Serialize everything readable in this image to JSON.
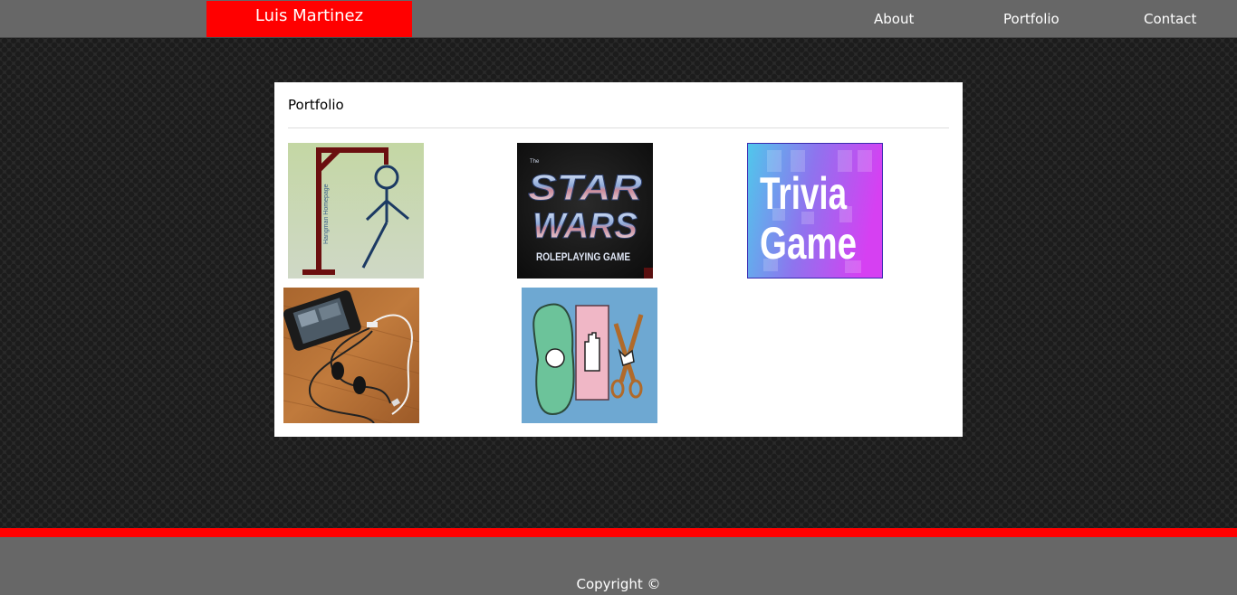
{
  "header": {
    "brand": "Luis Martinez",
    "nav": [
      {
        "label": "About"
      },
      {
        "label": "Portfolio"
      },
      {
        "label": "Contact"
      }
    ]
  },
  "portfolio": {
    "heading": "Portfolio",
    "projects": [
      {
        "name": "hangman",
        "thumb_text": "Hangman Homepage"
      },
      {
        "name": "star-wars-rpg",
        "thumb_text": [
          "The",
          "STAR",
          "WARS",
          "ROLEPLAYING GAME"
        ]
      },
      {
        "name": "trivia-game",
        "thumb_text": [
          "Trivia",
          "Game"
        ]
      },
      {
        "name": "music-player",
        "thumb_text": ""
      },
      {
        "name": "rock-paper-scissors",
        "thumb_text": ""
      }
    ]
  },
  "footer": {
    "copyright": "Copyright ©"
  },
  "colors": {
    "accent": "#ff0000",
    "nav_bg": "#676767",
    "page_bg": "#2a2a2a",
    "panel_bg": "#ffffff"
  }
}
